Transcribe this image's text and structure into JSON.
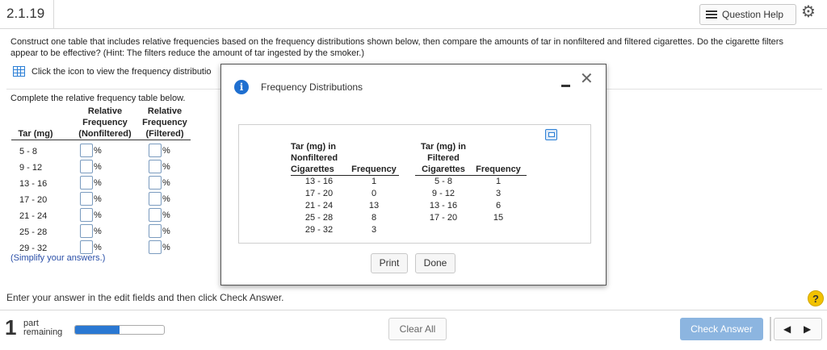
{
  "header": {
    "problem_number": "2.1.19",
    "question_help_label": "Question Help",
    "settings_icon": "gear-icon",
    "question_help_icon": "list-icon"
  },
  "prompt": {
    "text": "Construct one table that includes relative frequencies based on the frequency distributions shown below, then compare the amounts of tar in nonfiltered and filtered cigarettes. Do the cigarette filters appear to be effective? (Hint: The filters reduce the amount of tar ingested by the smoker.)",
    "icon_link_text": "Click the icon to view the frequency distributio"
  },
  "answer_table": {
    "instruction": "Complete the relative frequency table below.",
    "col_tar": "Tar (mg)",
    "col_nonfiltered": [
      "Relative",
      "Frequency",
      "(Nonfiltered)"
    ],
    "col_filtered": [
      "Relative",
      "Frequency",
      "(Filtered)"
    ],
    "percent_symbol": "%",
    "rows": [
      "5 - 8",
      "9 - 12",
      "13 - 16",
      "17 - 20",
      "21 - 24",
      "25 - 28",
      "29 - 32"
    ],
    "simplify_note": "(Simplify your answers.)"
  },
  "modal": {
    "title": "Frequency Distributions",
    "nonfiltered": {
      "header": [
        "Tar (mg) in",
        "Nonfiltered",
        "Cigarettes"
      ],
      "freq_header": "Frequency",
      "classes": [
        "13 - 16",
        "17 - 20",
        "21 - 24",
        "25 - 28",
        "29 - 32"
      ],
      "frequencies": [
        "1",
        "0",
        "13",
        "8",
        "3"
      ]
    },
    "filtered": {
      "header": [
        "Tar (mg) in",
        "Filtered",
        "Cigarettes"
      ],
      "freq_header": "Frequency",
      "classes": [
        "5 - 8",
        "9 - 12",
        "13 - 16",
        "17 - 20"
      ],
      "frequencies": [
        "1",
        "3",
        "6",
        "15"
      ]
    },
    "print_label": "Print",
    "done_label": "Done"
  },
  "footer": {
    "instruction": "Enter your answer in the edit fields and then click Check Answer.",
    "help_symbol": "?",
    "part_number": "1",
    "part_label_1": "part",
    "part_label_2": "remaining",
    "progress_fraction": 0.5,
    "clear_all_label": "Clear All",
    "check_answer_label": "Check Answer",
    "prev_symbol": "◀",
    "next_symbol": "▶"
  }
}
